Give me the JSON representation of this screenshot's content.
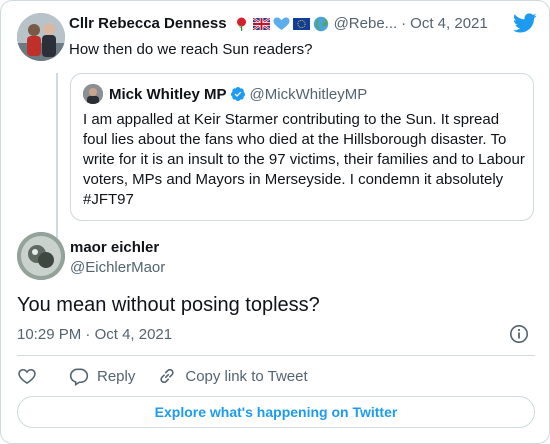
{
  "parent_tweet": {
    "name": "Cllr Rebecca Denness",
    "handle": "@Rebe...",
    "separator": "·",
    "date": "Oct 4, 2021",
    "text": "How then do we reach Sun readers?",
    "name_emojis": [
      "rose-icon",
      "uk-flag-icon",
      "blue-heart-icon",
      "eu-flag-icon",
      "globe-icon"
    ]
  },
  "quoted_tweet": {
    "name": "Mick Whitley MP",
    "handle": "@MickWhitleyMP",
    "verified": true,
    "text": "I am appalled at Keir Starmer contributing to the Sun. It spread foul lies about the fans who died at the Hillsborough disaster. To write for it is an insult to the 97 victims, their families and to Labour voters, MPs and Mayors in Merseyside. I condemn it absolutely  #JFT97"
  },
  "main_tweet": {
    "name": "maor eichler",
    "handle": "@EichlerMaor",
    "text": "You mean without posing topless?",
    "time": "10:29 PM",
    "separator": "·",
    "date": "Oct 4, 2021"
  },
  "actions": {
    "reply_label": "Reply",
    "copy_label": "Copy link to Tweet"
  },
  "explore_label": "Explore what's happening on Twitter",
  "colors": {
    "accent": "#1d9bf0",
    "secondary_text": "#536471",
    "border": "#cfd9de"
  }
}
